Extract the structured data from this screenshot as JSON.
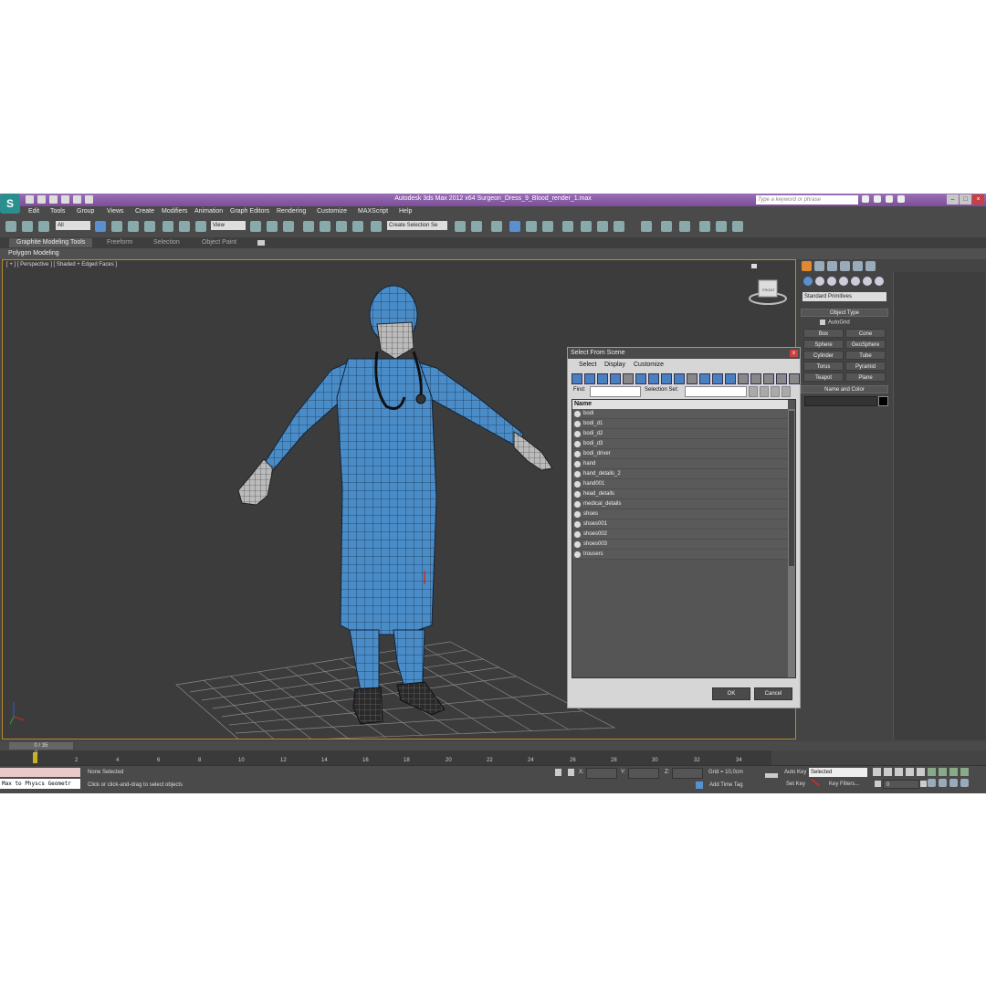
{
  "app": {
    "logo": "S",
    "title": "Autodesk 3ds Max  2012 x64      Surgeon_Dress_9_Blood_render_1.max",
    "search_placeholder": "Type a keyword or phrase"
  },
  "menu": [
    "Edit",
    "Tools",
    "Group",
    "Views",
    "Create",
    "Modifiers",
    "Animation",
    "Graph Editors",
    "Rendering",
    "Customize",
    "MAXScript",
    "Help"
  ],
  "toolbar": {
    "filter_dropdown": "All",
    "refcoord_dropdown": "View",
    "selection_set_dropdown": "Create Selection Se"
  },
  "ribbon": {
    "tabs": [
      "Graphite Modeling Tools",
      "Freeform",
      "Selection",
      "Object Paint"
    ],
    "active_tab": "Graphite Modeling Tools",
    "sub_label": "Polygon Modeling"
  },
  "viewport": {
    "label": "[ + ] [ Perspective ] [ Shaded + Edged Faces ]",
    "viewcube_label": "FRONT"
  },
  "command_panel": {
    "dropdown": "Standard Primitives",
    "object_type_title": "Object Type",
    "autogrid_label": "AutoGrid",
    "primitives": [
      "Box",
      "Cone",
      "Sphere",
      "GeoSphere",
      "Cylinder",
      "Tube",
      "Torus",
      "Pyramid",
      "Teapot",
      "Plane"
    ],
    "name_color_title": "Name and Color"
  },
  "dialog": {
    "title": "Select From Scene",
    "close": "x",
    "menu": [
      "Select",
      "Display",
      "Customize"
    ],
    "find_label": "Find:",
    "selection_set_label": "Selection Set:",
    "column_header": "Name",
    "objects": [
      "bodi",
      "bodi_d1",
      "bodi_d2",
      "bodi_d3",
      "bodi_driver",
      "hand",
      "hand_details_2",
      "hand001",
      "head_details",
      "medical_details",
      "shoes",
      "shoes001",
      "shoes002",
      "shoes003",
      "trousers"
    ],
    "ok_label": "OK",
    "cancel_label": "Cancel"
  },
  "timeline": {
    "slider_label": "0 / 35",
    "ticks": [
      "0",
      "2",
      "4",
      "6",
      "8",
      "10",
      "12",
      "14",
      "16",
      "18",
      "20",
      "22",
      "24",
      "26",
      "28",
      "30",
      "32",
      "34"
    ]
  },
  "status": {
    "selection_text": "None Selected",
    "prompt_text": "Click or click-and-drag to select objects",
    "maxscript_text": "Max to Physcs Geometr",
    "x_label": "X:",
    "y_label": "Y:",
    "z_label": "Z:",
    "grid_text": "Grid = 10,0cm",
    "add_time_tag": "Add Time Tag",
    "auto_key": "Auto Key",
    "set_key": "Set Key",
    "key_mode_dropdown": "Selected",
    "key_filters": "Key Filters...",
    "current_frame": "0"
  },
  "colors": {
    "title_bar": "#8a5fa8",
    "model_blue": "#4a8cc8",
    "viewport_bg": "#3c3c3c",
    "active_border": "#b88a2a"
  }
}
